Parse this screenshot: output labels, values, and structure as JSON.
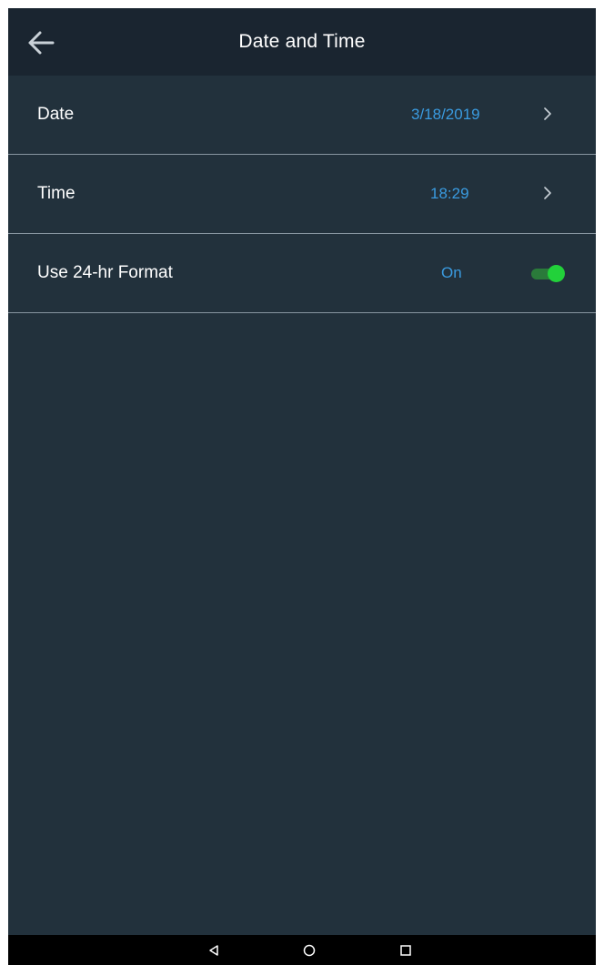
{
  "app_bar": {
    "title": "Date and Time",
    "back_icon": "arrow-left-icon"
  },
  "settings": {
    "date": {
      "label": "Date",
      "value": "3/18/2019",
      "icon": "chevron-right-icon"
    },
    "time": {
      "label": "Time",
      "value": "18:29",
      "icon": "chevron-right-icon"
    },
    "format_24hr": {
      "label": "Use 24-hr Format",
      "value": "On",
      "toggle_on": true
    }
  },
  "nav_bar": {
    "back_icon": "nav-back-icon",
    "home_icon": "nav-home-icon",
    "recents_icon": "nav-recents-icon"
  },
  "colors": {
    "background": "#22313c",
    "app_bar": "#1a2530",
    "value_accent": "#3a9be0",
    "toggle_on": "#22d13a",
    "divider": "#8896a1"
  }
}
